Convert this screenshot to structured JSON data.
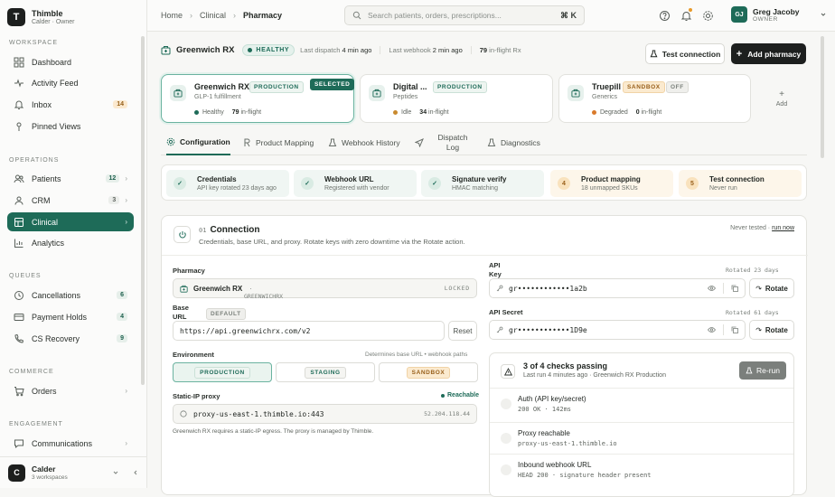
{
  "brand": {
    "name": "Thimble",
    "subtitle": "Calder · Owner",
    "logo_letter": "T"
  },
  "sidebar": {
    "workspace_title": "WORKSPACE",
    "workspace_items": [
      {
        "label": "Dashboard",
        "icon": "dashboard-icon"
      },
      {
        "label": "Activity Feed",
        "icon": "activity-icon"
      },
      {
        "label": "Inbox",
        "icon": "bell-icon",
        "badge": "14"
      },
      {
        "label": "Pinned Views",
        "icon": "pin-icon"
      }
    ],
    "operations_title": "OPERATIONS",
    "operations_items": [
      {
        "label": "Patients",
        "icon": "users-icon",
        "badge": "12"
      },
      {
        "label": "CRM",
        "icon": "crm-icon",
        "badge": "3"
      },
      {
        "label": "Clinical",
        "icon": "clinical-icon"
      },
      {
        "label": "Analytics",
        "icon": "chart-icon"
      }
    ],
    "queues_title": "QUEUES",
    "queue_items": [
      {
        "label": "Cancellations",
        "icon": "clock-icon",
        "badge": "6"
      },
      {
        "label": "Payment Holds",
        "icon": "card-icon",
        "badge": "4"
      },
      {
        "label": "CS Recovery",
        "icon": "phone-icon",
        "badge": "9"
      }
    ],
    "commerce_title": "COMMERCE",
    "commerce_items": [
      {
        "label": "Orders",
        "icon": "cart-icon"
      }
    ],
    "engagement_title": "ENGAGEMENT",
    "engagement_items": [
      {
        "label": "Communications",
        "icon": "message-icon"
      }
    ],
    "footer": {
      "name": "Calder",
      "sub": "3 workspaces",
      "letter": "C"
    }
  },
  "topbar": {
    "breadcrumbs": [
      "Home",
      "Clinical",
      "Pharmacy"
    ],
    "search_placeholder": "Search patients, orders, prescriptions...",
    "search_shortcut": "⌘ K",
    "user": {
      "name": "Greg Jacoby",
      "role": "OWNER",
      "initials": "GJ"
    }
  },
  "header": {
    "title": "Greenwich RX",
    "status": "HEALTHY",
    "last_dispatch_label": "Last dispatch",
    "last_dispatch": "4 min ago",
    "last_webhook_label": "Last webhook",
    "last_webhook": "2 min ago",
    "inflight_count": "79",
    "inflight_label": "in-flight Rx",
    "test_button": "Test connection",
    "add_button": "Add pharmacy"
  },
  "pharmacies": [
    {
      "name": "Greenwich RX",
      "env": "PRODUCTION",
      "selected": "SELECTED",
      "sub": "GLP-1 fulfillment",
      "status": "Healthy",
      "count": "79",
      "count_label": "in-flight",
      "dot": "#1e6b58"
    },
    {
      "name": "Digital ...",
      "env": "PRODUCTION",
      "sub": "Peptides",
      "status": "Idle",
      "count": "34",
      "count_label": "in-flight",
      "dot": "#c98a2e"
    },
    {
      "name": "Truepill",
      "env": "SANDBOX",
      "off": "OFF",
      "sub": "Generics",
      "status": "Degraded",
      "count": "0",
      "count_label": "in-flight",
      "dot": "#d97a2b"
    }
  ],
  "add_card": {
    "plus": "+",
    "label": "Add"
  },
  "tabs": [
    {
      "label": "Configuration",
      "icon": "gear-icon"
    },
    {
      "label": "Product Mapping",
      "icon": "mapping-icon"
    },
    {
      "label": "Webhook History",
      "icon": "flask-icon"
    },
    {
      "label": "Dispatch Log",
      "icon": "send-icon"
    },
    {
      "label": "Diagnostics",
      "icon": "flask-icon"
    }
  ],
  "steps": [
    {
      "title": "Credentials",
      "sub": "API key rotated 23 days ago",
      "mark": "✓"
    },
    {
      "title": "Webhook URL",
      "sub": "Registered with vendor",
      "mark": "✓"
    },
    {
      "title": "Signature verify",
      "sub": "HMAC matching",
      "mark": "✓"
    },
    {
      "title": "Product mapping",
      "sub": "18 unmapped SKUs",
      "mark": "4"
    },
    {
      "title": "Test connection",
      "sub": "Never run",
      "mark": "5"
    }
  ],
  "connection": {
    "number": "01",
    "title": "Connection",
    "subtitle": "Credentials, base URL, and proxy. Rotate keys with zero downtime via the Rotate action.",
    "never_tested": "Never tested ·",
    "run_now": "run now",
    "pharmacy_label": "Pharmacy",
    "pharmacy_value": "Greenwich RX",
    "pharmacy_code_sep": "·",
    "pharmacy_code": "GREENWICHRX",
    "locked": "LOCKED",
    "base_url_label_1": "Base",
    "base_url_label_2": "URL",
    "default_tag": "DEFAULT",
    "base_url_value": "https://api.greenwichrx.com/v2",
    "reset": "Reset",
    "env_label": "Environment",
    "env_hint": "Determines base URL • webhook paths",
    "env_options": [
      "PRODUCTION",
      "STAGING",
      "SANDBOX"
    ],
    "proxy_label": "Static-IP proxy",
    "proxy_status": "Reachable",
    "proxy_value": "proxy-us-east-1.thimble.io:443",
    "proxy_ip": "52.204.118.44",
    "proxy_note": "Greenwich RX requires a static-IP egress. The proxy is managed by Thimble.",
    "api_key_label_1": "API",
    "api_key_label_2": "Key",
    "api_key_rotated": "Rotated 23 days",
    "api_key_value": "gr••••••••••••1a2b",
    "api_secret_label": "API Secret",
    "api_secret_rotated": "Rotated 61 days",
    "api_secret_value": "gr••••••••••••1D9e",
    "rotate": "Rotate"
  },
  "checks": {
    "title": "3 of 4 checks passing",
    "sub": "Last run 4 minutes ago · Greenwich RX Production",
    "rerun": "Re-run",
    "items": [
      {
        "name": "Auth (API key/secret)",
        "detail": "200 OK · 142ms"
      },
      {
        "name": "Proxy reachable",
        "detail": "proxy-us-east-1.thimble.io"
      },
      {
        "name": "Inbound webhook URL",
        "detail": "HEAD 200 · signature header present"
      }
    ]
  },
  "colors": {
    "accent": "#1e6b58",
    "amber": "#e89a2a",
    "dark": "#1d1f1e"
  }
}
